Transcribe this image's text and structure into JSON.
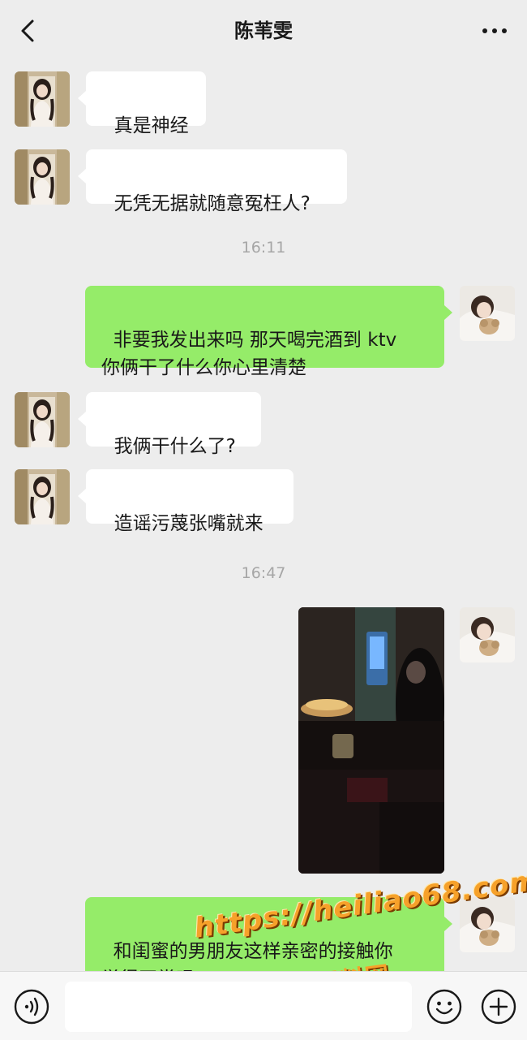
{
  "header": {
    "title": "陈苇雯",
    "back_icon": "chevron-left-icon",
    "more_icon": "more-dots-icon"
  },
  "messages": [
    {
      "sender": "other",
      "type": "text",
      "text": "真是神经"
    },
    {
      "sender": "other",
      "type": "text",
      "text": "无凭无据就随意冤枉人?"
    },
    {
      "type": "timestamp",
      "text": "16:11"
    },
    {
      "sender": "me",
      "type": "text",
      "text": "非要我发出来吗 那天喝完酒到 ktv\n你俩干了什么你心里清楚"
    },
    {
      "sender": "other",
      "type": "text",
      "text": "我俩干什么了?"
    },
    {
      "sender": "other",
      "type": "text",
      "text": "造谣污蔑张嘴就来"
    },
    {
      "type": "timestamp",
      "text": "16:47"
    },
    {
      "sender": "me",
      "type": "image",
      "description_icon": "photo-icon"
    },
    {
      "sender": "me",
      "type": "text",
      "text": "和闺蜜的男朋友这样亲密的接触你\n觉得正常吗"
    }
  ],
  "watermark": {
    "url": "https://heiliao68.com",
    "text": "黑料网"
  },
  "input_bar": {
    "voice_icon": "voice-icon",
    "emoji_icon": "emoji-icon",
    "plus_icon": "plus-circle-icon",
    "value": ""
  },
  "colors": {
    "background": "#ededed",
    "incoming_bubble": "#ffffff",
    "outgoing_bubble": "#95ec69",
    "timestamp": "#a6a6a6",
    "watermark": "#f6a12a"
  }
}
